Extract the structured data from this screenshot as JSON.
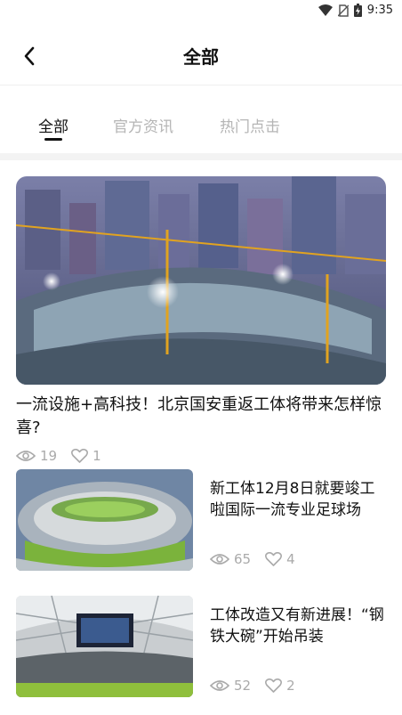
{
  "status_bar": {
    "time": "9:35",
    "icons": [
      "wifi-icon",
      "no-sim-icon",
      "battery-icon"
    ]
  },
  "header": {
    "title": "全部",
    "back_icon": "chevron-left-icon"
  },
  "tabs": [
    {
      "label": "全部",
      "active": true
    },
    {
      "label": "官方资讯",
      "active": false
    },
    {
      "label": "热门点击",
      "active": false
    }
  ],
  "feature": {
    "title": "一流设施+高科技！北京国安重返工体将带来怎样惊喜?",
    "views": "19",
    "likes": "1"
  },
  "articles": [
    {
      "title": "新工体12月8日就要竣工啦国际一流专业足球场",
      "views": "65",
      "likes": "4"
    },
    {
      "title": "工体改造又有新进展！“钢铁大碗”开始吊装",
      "views": "52",
      "likes": "2"
    }
  ],
  "colors": {
    "active_tab": "#111111",
    "inactive_tab": "#b5b5b5",
    "meta": "#aaaaaa"
  }
}
